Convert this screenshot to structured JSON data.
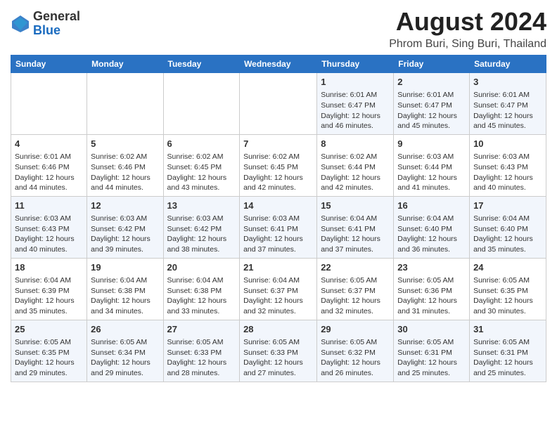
{
  "header": {
    "logo_general": "General",
    "logo_blue": "Blue",
    "title": "August 2024",
    "subtitle": "Phrom Buri, Sing Buri, Thailand"
  },
  "days_of_week": [
    "Sunday",
    "Monday",
    "Tuesday",
    "Wednesday",
    "Thursday",
    "Friday",
    "Saturday"
  ],
  "weeks": [
    [
      {
        "day": "",
        "content": ""
      },
      {
        "day": "",
        "content": ""
      },
      {
        "day": "",
        "content": ""
      },
      {
        "day": "",
        "content": ""
      },
      {
        "day": "1",
        "content": "Sunrise: 6:01 AM\nSunset: 6:47 PM\nDaylight: 12 hours\nand 46 minutes."
      },
      {
        "day": "2",
        "content": "Sunrise: 6:01 AM\nSunset: 6:47 PM\nDaylight: 12 hours\nand 45 minutes."
      },
      {
        "day": "3",
        "content": "Sunrise: 6:01 AM\nSunset: 6:47 PM\nDaylight: 12 hours\nand 45 minutes."
      }
    ],
    [
      {
        "day": "4",
        "content": "Sunrise: 6:01 AM\nSunset: 6:46 PM\nDaylight: 12 hours\nand 44 minutes."
      },
      {
        "day": "5",
        "content": "Sunrise: 6:02 AM\nSunset: 6:46 PM\nDaylight: 12 hours\nand 44 minutes."
      },
      {
        "day": "6",
        "content": "Sunrise: 6:02 AM\nSunset: 6:45 PM\nDaylight: 12 hours\nand 43 minutes."
      },
      {
        "day": "7",
        "content": "Sunrise: 6:02 AM\nSunset: 6:45 PM\nDaylight: 12 hours\nand 42 minutes."
      },
      {
        "day": "8",
        "content": "Sunrise: 6:02 AM\nSunset: 6:44 PM\nDaylight: 12 hours\nand 42 minutes."
      },
      {
        "day": "9",
        "content": "Sunrise: 6:03 AM\nSunset: 6:44 PM\nDaylight: 12 hours\nand 41 minutes."
      },
      {
        "day": "10",
        "content": "Sunrise: 6:03 AM\nSunset: 6:43 PM\nDaylight: 12 hours\nand 40 minutes."
      }
    ],
    [
      {
        "day": "11",
        "content": "Sunrise: 6:03 AM\nSunset: 6:43 PM\nDaylight: 12 hours\nand 40 minutes."
      },
      {
        "day": "12",
        "content": "Sunrise: 6:03 AM\nSunset: 6:42 PM\nDaylight: 12 hours\nand 39 minutes."
      },
      {
        "day": "13",
        "content": "Sunrise: 6:03 AM\nSunset: 6:42 PM\nDaylight: 12 hours\nand 38 minutes."
      },
      {
        "day": "14",
        "content": "Sunrise: 6:03 AM\nSunset: 6:41 PM\nDaylight: 12 hours\nand 37 minutes."
      },
      {
        "day": "15",
        "content": "Sunrise: 6:04 AM\nSunset: 6:41 PM\nDaylight: 12 hours\nand 37 minutes."
      },
      {
        "day": "16",
        "content": "Sunrise: 6:04 AM\nSunset: 6:40 PM\nDaylight: 12 hours\nand 36 minutes."
      },
      {
        "day": "17",
        "content": "Sunrise: 6:04 AM\nSunset: 6:40 PM\nDaylight: 12 hours\nand 35 minutes."
      }
    ],
    [
      {
        "day": "18",
        "content": "Sunrise: 6:04 AM\nSunset: 6:39 PM\nDaylight: 12 hours\nand 35 minutes."
      },
      {
        "day": "19",
        "content": "Sunrise: 6:04 AM\nSunset: 6:38 PM\nDaylight: 12 hours\nand 34 minutes."
      },
      {
        "day": "20",
        "content": "Sunrise: 6:04 AM\nSunset: 6:38 PM\nDaylight: 12 hours\nand 33 minutes."
      },
      {
        "day": "21",
        "content": "Sunrise: 6:04 AM\nSunset: 6:37 PM\nDaylight: 12 hours\nand 32 minutes."
      },
      {
        "day": "22",
        "content": "Sunrise: 6:05 AM\nSunset: 6:37 PM\nDaylight: 12 hours\nand 32 minutes."
      },
      {
        "day": "23",
        "content": "Sunrise: 6:05 AM\nSunset: 6:36 PM\nDaylight: 12 hours\nand 31 minutes."
      },
      {
        "day": "24",
        "content": "Sunrise: 6:05 AM\nSunset: 6:35 PM\nDaylight: 12 hours\nand 30 minutes."
      }
    ],
    [
      {
        "day": "25",
        "content": "Sunrise: 6:05 AM\nSunset: 6:35 PM\nDaylight: 12 hours\nand 29 minutes."
      },
      {
        "day": "26",
        "content": "Sunrise: 6:05 AM\nSunset: 6:34 PM\nDaylight: 12 hours\nand 29 minutes."
      },
      {
        "day": "27",
        "content": "Sunrise: 6:05 AM\nSunset: 6:33 PM\nDaylight: 12 hours\nand 28 minutes."
      },
      {
        "day": "28",
        "content": "Sunrise: 6:05 AM\nSunset: 6:33 PM\nDaylight: 12 hours\nand 27 minutes."
      },
      {
        "day": "29",
        "content": "Sunrise: 6:05 AM\nSunset: 6:32 PM\nDaylight: 12 hours\nand 26 minutes."
      },
      {
        "day": "30",
        "content": "Sunrise: 6:05 AM\nSunset: 6:31 PM\nDaylight: 12 hours\nand 25 minutes."
      },
      {
        "day": "31",
        "content": "Sunrise: 6:05 AM\nSunset: 6:31 PM\nDaylight: 12 hours\nand 25 minutes."
      }
    ]
  ]
}
